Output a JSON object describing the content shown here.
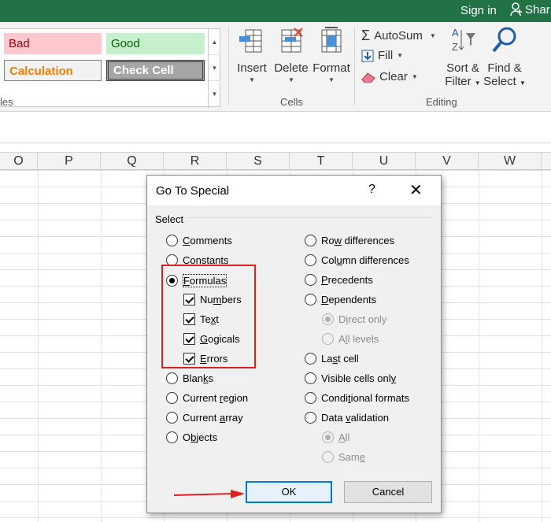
{
  "topbar": {
    "signin": "Sign in",
    "share": "Shar"
  },
  "styles": {
    "bad": "Bad",
    "good": "Good",
    "calculation": "Calculation",
    "check_cell": "Check Cell",
    "group_label": "les"
  },
  "cells_group": {
    "insert": "Insert",
    "delete": "Delete",
    "format": "Format",
    "label": "Cells"
  },
  "editing_group": {
    "autosum": "AutoSum",
    "fill": "Fill",
    "clear": "Clear",
    "sort_line1": "Sort &",
    "sort_line2": "Filter",
    "find_line1": "Find &",
    "find_line2": "Select",
    "label": "Editing"
  },
  "columns": [
    "O",
    "P",
    "Q",
    "R",
    "S",
    "T",
    "U",
    "V",
    "W"
  ],
  "dialog": {
    "title": "Go To Special",
    "help": "?",
    "close": "✕",
    "group_label": "Select",
    "left_options": [
      {
        "pre": "",
        "u": "C",
        "post": "omments"
      },
      {
        "pre": "C",
        "u": "o",
        "post": "nstants"
      },
      {
        "pre": "",
        "u": "F",
        "post": "ormulas"
      },
      {
        "pre": "Nu",
        "u": "m",
        "post": "bers"
      },
      {
        "pre": "Te",
        "u": "x",
        "post": "t"
      },
      {
        "pre": "",
        "u": "G",
        "post": "ogicals"
      },
      {
        "pre": "",
        "u": "E",
        "post": "rrors"
      },
      {
        "pre": "Blan",
        "u": "k",
        "post": "s"
      },
      {
        "pre": "Current ",
        "u": "r",
        "post": "egion"
      },
      {
        "pre": "Current ",
        "u": "a",
        "post": "rray"
      },
      {
        "pre": "O",
        "u": "b",
        "post": "jects"
      }
    ],
    "right_options": [
      {
        "pre": "Ro",
        "u": "w",
        "post": " differences"
      },
      {
        "pre": "Col",
        "u": "u",
        "post": "mn differences"
      },
      {
        "pre": "",
        "u": "P",
        "post": "recedents"
      },
      {
        "pre": "",
        "u": "D",
        "post": "ependents"
      },
      {
        "pre": "D",
        "u": "i",
        "post": "rect only"
      },
      {
        "pre": "A",
        "u": "l",
        "post": "l levels"
      },
      {
        "pre": "La",
        "u": "s",
        "post": "t cell"
      },
      {
        "pre": "Visible cells onl",
        "u": "y",
        "post": ""
      },
      {
        "pre": "Condi",
        "u": "t",
        "post": "ional formats"
      },
      {
        "pre": "Data ",
        "u": "v",
        "post": "alidation"
      },
      {
        "pre": "",
        "u": "A",
        "post": "ll"
      },
      {
        "pre": "Sam",
        "u": "e",
        "post": ""
      }
    ],
    "ok": "OK",
    "cancel": "Cancel"
  },
  "colors": {
    "excel_green": "#217346",
    "highlight_red": "#e02020",
    "ok_border": "#0078d7"
  }
}
